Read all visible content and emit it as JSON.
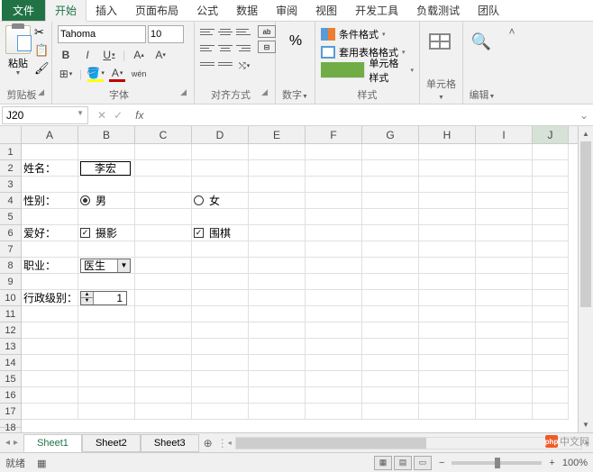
{
  "tabs": {
    "file": "文件",
    "home": "开始",
    "insert": "插入",
    "layout": "页面布局",
    "formulas": "公式",
    "data": "数据",
    "review": "审阅",
    "view": "视图",
    "developer": "开发工具",
    "loadtest": "负载测试",
    "team": "团队"
  },
  "ribbon": {
    "clipboard": {
      "paste": "粘贴",
      "label": "剪贴板"
    },
    "font": {
      "name": "Tahoma",
      "size": "10",
      "label": "字体",
      "wen": "wén"
    },
    "alignment": {
      "label": "对齐方式"
    },
    "number": {
      "label": "数字",
      "symbol": "%"
    },
    "styles": {
      "cond": "条件格式",
      "table": "套用表格格式",
      "cell": "单元格样式",
      "label": "样式"
    },
    "cells": {
      "label": "单元格"
    },
    "editing": {
      "label": "编辑"
    }
  },
  "namebox": "J20",
  "columns": [
    "A",
    "B",
    "C",
    "D",
    "E",
    "F",
    "G",
    "H",
    "I",
    "J"
  ],
  "rows": [
    "1",
    "2",
    "3",
    "4",
    "5",
    "6",
    "7",
    "8",
    "9",
    "10",
    "11",
    "12",
    "13",
    "14",
    "15",
    "16",
    "17",
    "18"
  ],
  "form": {
    "name_label": "姓名：",
    "name_value": "李宏",
    "gender_label": "性别：",
    "gender_male": "男",
    "gender_female": "女",
    "hobby_label": "爱好：",
    "hobby_photo": "摄影",
    "hobby_go": "围棋",
    "job_label": "职业：",
    "job_value": "医生",
    "rank_label": "行政级别：",
    "rank_value": "1"
  },
  "sheets": {
    "s1": "Sheet1",
    "s2": "Sheet2",
    "s3": "Sheet3"
  },
  "status": {
    "ready": "就绪",
    "zoom": "100%"
  },
  "watermark": "中文网"
}
